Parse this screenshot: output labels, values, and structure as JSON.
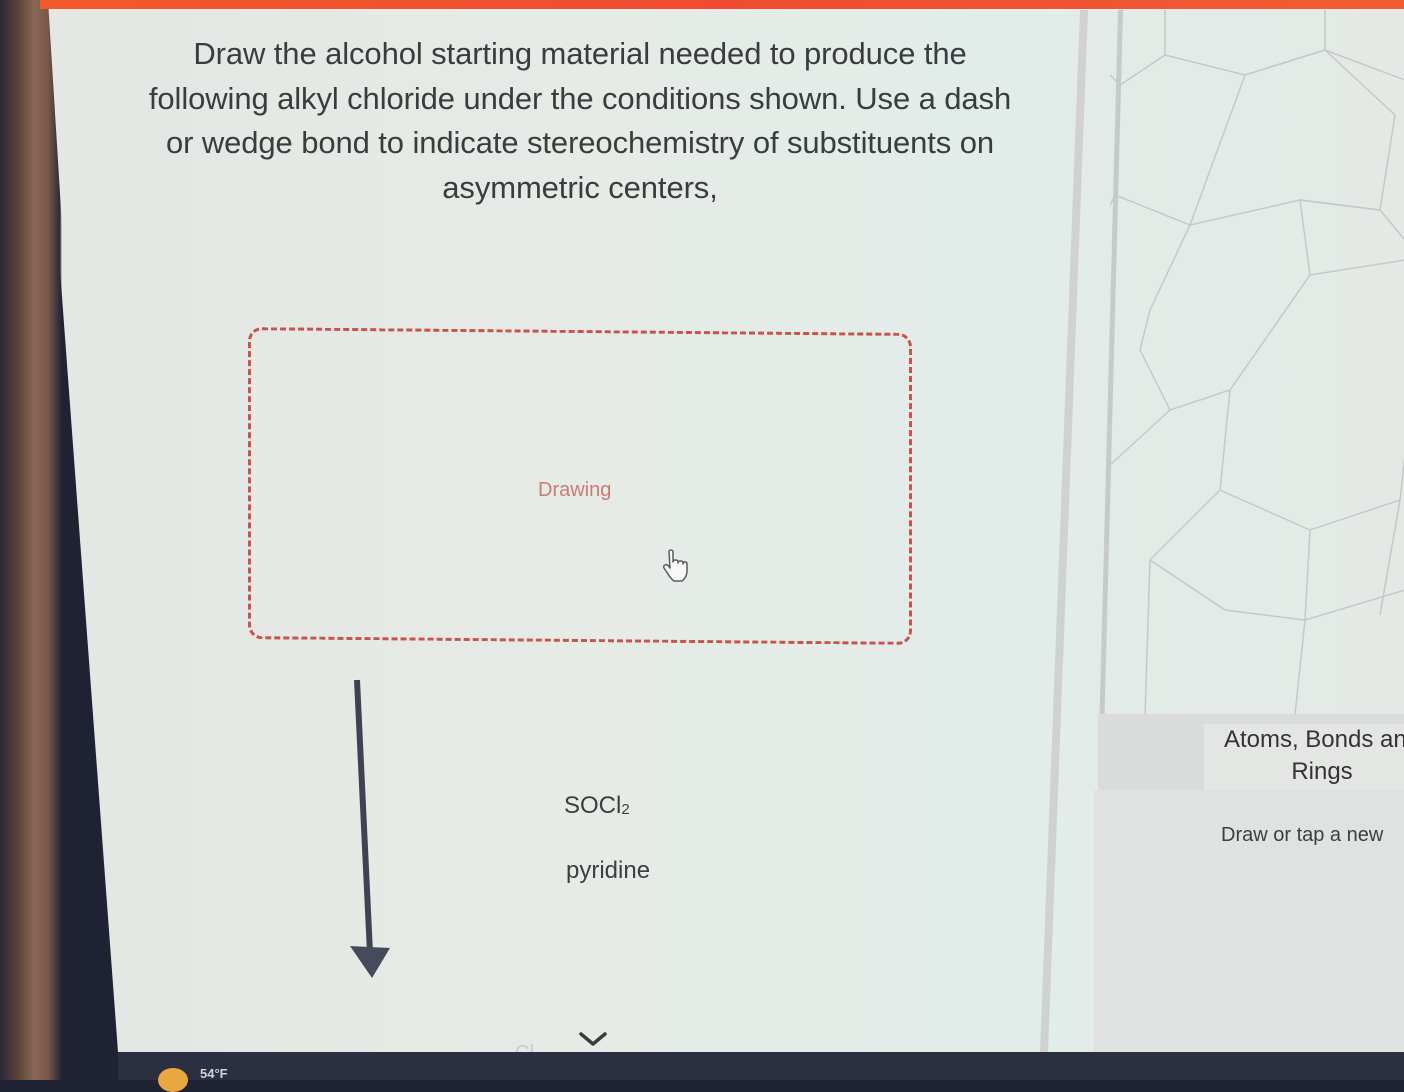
{
  "question": {
    "lines": [
      "Draw the alcohol starting material needed to produce the",
      "following alkyl chloride under the conditions shown. Use a dash",
      "or wedge bond to indicate stereochemistry of substituents on",
      "asymmetric centers,"
    ]
  },
  "drawing_area": {
    "label": "Drawing",
    "border_color": "#c7534f"
  },
  "reaction": {
    "reagent_1": {
      "base": "SOCl",
      "subscript": "2"
    },
    "reagent_2": "pyridine",
    "arrow_direction": "down"
  },
  "toolbar_panel": {
    "title": "Atoms, Bonds and Rings",
    "hint": "Draw or tap a new"
  },
  "taskbar": {
    "weather_temp": "54°F"
  },
  "icons": {
    "cursor": "hand-pointer-icon",
    "expand": "chevron-down-icon",
    "weather": "sun-icon"
  },
  "colors": {
    "accent_bar": "#f15a2b",
    "text": "#3a3c3f"
  }
}
